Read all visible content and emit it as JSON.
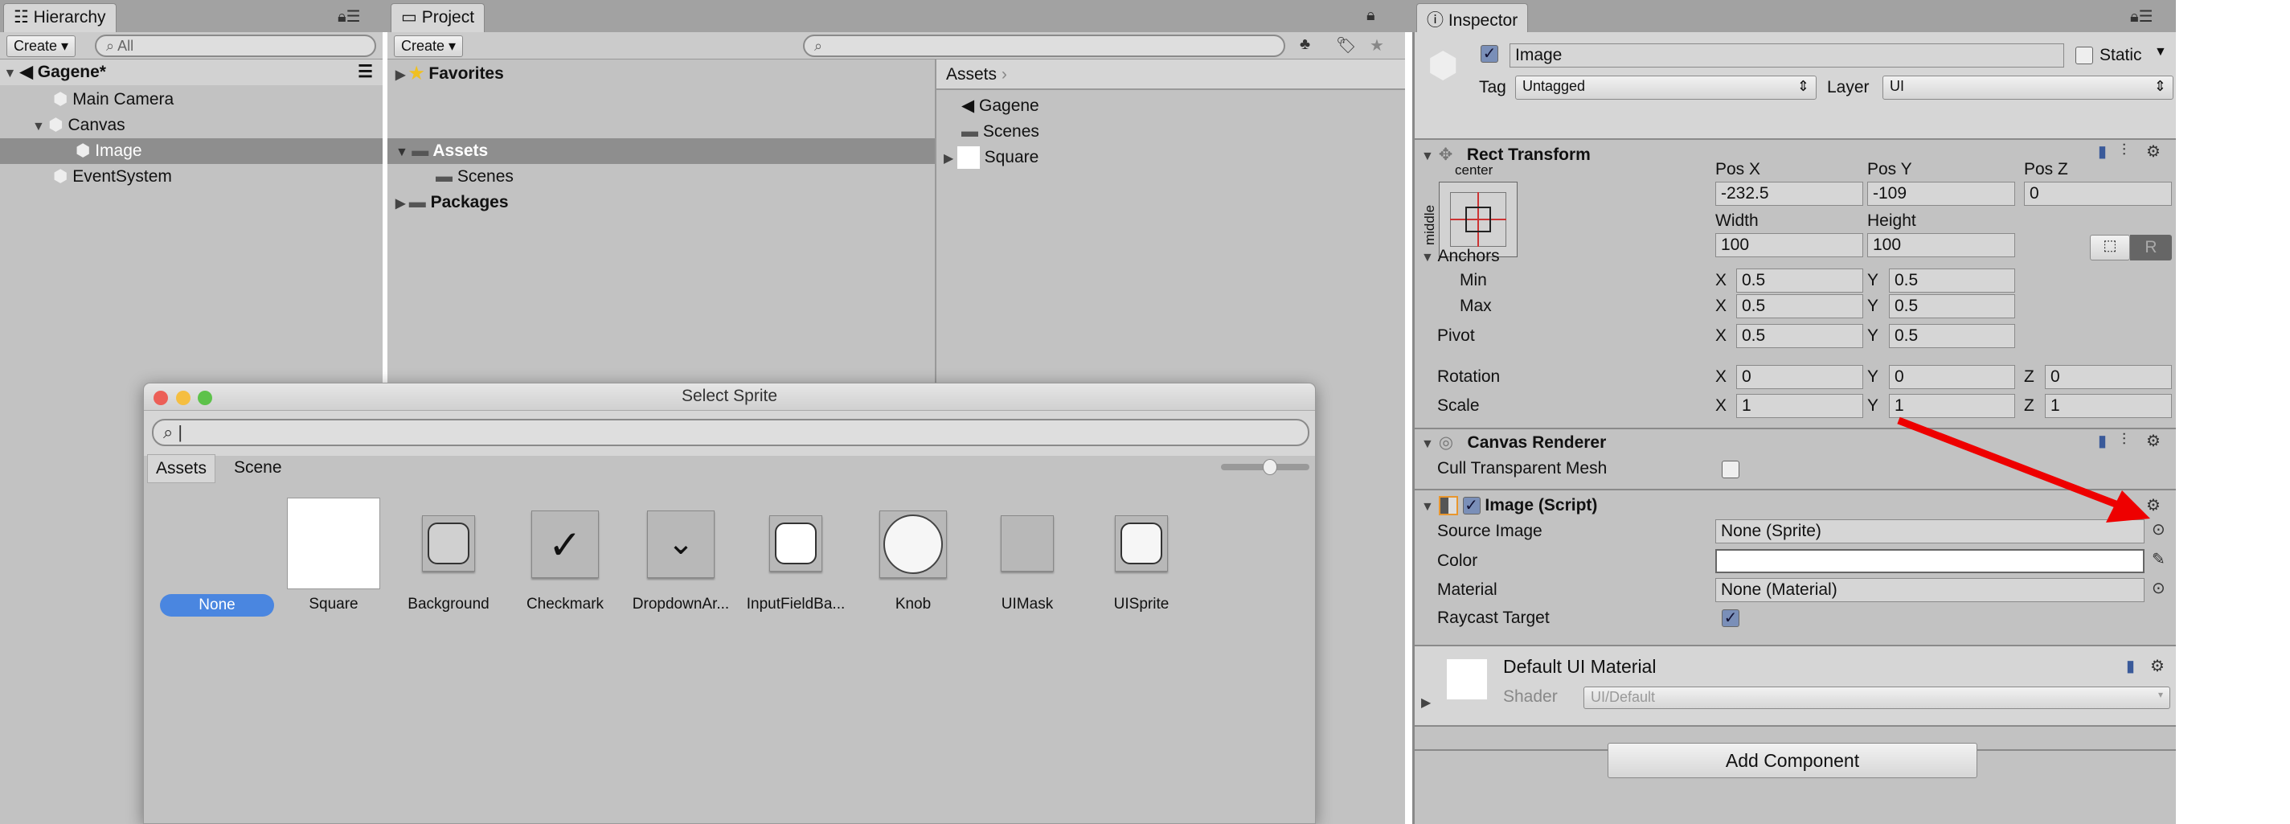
{
  "hierarchy": {
    "tab": "Hierarchy",
    "create": "Create",
    "search_placeholder": "All",
    "scene": "Gagene*",
    "items": [
      "Main Camera",
      "Canvas",
      "Image",
      "EventSystem"
    ]
  },
  "project": {
    "tab": "Project",
    "create": "Create",
    "tree": {
      "favorites": "Favorites",
      "assets": "Assets",
      "scenes": "Scenes",
      "packages": "Packages"
    },
    "breadcrumb": "Assets",
    "files": [
      "Gagene",
      "Scenes",
      "Square"
    ]
  },
  "inspector": {
    "tab": "Inspector",
    "name": "Image",
    "static": "Static",
    "tag_label": "Tag",
    "tag": "Untagged",
    "layer_label": "Layer",
    "layer": "UI",
    "rect": {
      "title": "Rect Transform",
      "anchor_h": "center",
      "anchor_v": "middle",
      "posx_l": "Pos X",
      "posy_l": "Pos Y",
      "posz_l": "Pos Z",
      "posx": "-232.5",
      "posy": "-109",
      "posz": "0",
      "width_l": "Width",
      "height_l": "Height",
      "width": "100",
      "height": "100",
      "raw": "R",
      "anchors": "Anchors",
      "min": "Min",
      "max": "Max",
      "pivot": "Pivot",
      "rotation": "Rotation",
      "scale": "Scale",
      "x": "X",
      "y": "Y",
      "z": "Z",
      "min_x": "0.5",
      "min_y": "0.5",
      "max_x": "0.5",
      "max_y": "0.5",
      "pivot_x": "0.5",
      "pivot_y": "0.5",
      "rot_x": "0",
      "rot_y": "0",
      "rot_z": "0",
      "scale_x": "1",
      "scale_y": "1",
      "scale_z": "1"
    },
    "canvas_renderer": {
      "title": "Canvas Renderer",
      "cull": "Cull Transparent Mesh",
      "cull_checked": false
    },
    "image": {
      "title": "Image (Script)",
      "source_l": "Source Image",
      "source": "None (Sprite)",
      "color_l": "Color",
      "color": "#ffffff",
      "material_l": "Material",
      "material": "None (Material)",
      "raycast_l": "Raycast Target",
      "raycast_checked": true
    },
    "material": {
      "title": "Default UI Material",
      "shader_l": "Shader",
      "shader": "UI/Default"
    },
    "add_component": "Add Component"
  },
  "dialog": {
    "title": "Select Sprite",
    "tabs": [
      "Assets",
      "Scene"
    ],
    "items": [
      "None",
      "Square",
      "Background",
      "Checkmark",
      "DropdownAr...",
      "InputFieldBa...",
      "Knob",
      "UIMask",
      "UISprite"
    ],
    "accent": "#4a86e0"
  },
  "annotation": {
    "arrow_color": "#ee0000"
  }
}
